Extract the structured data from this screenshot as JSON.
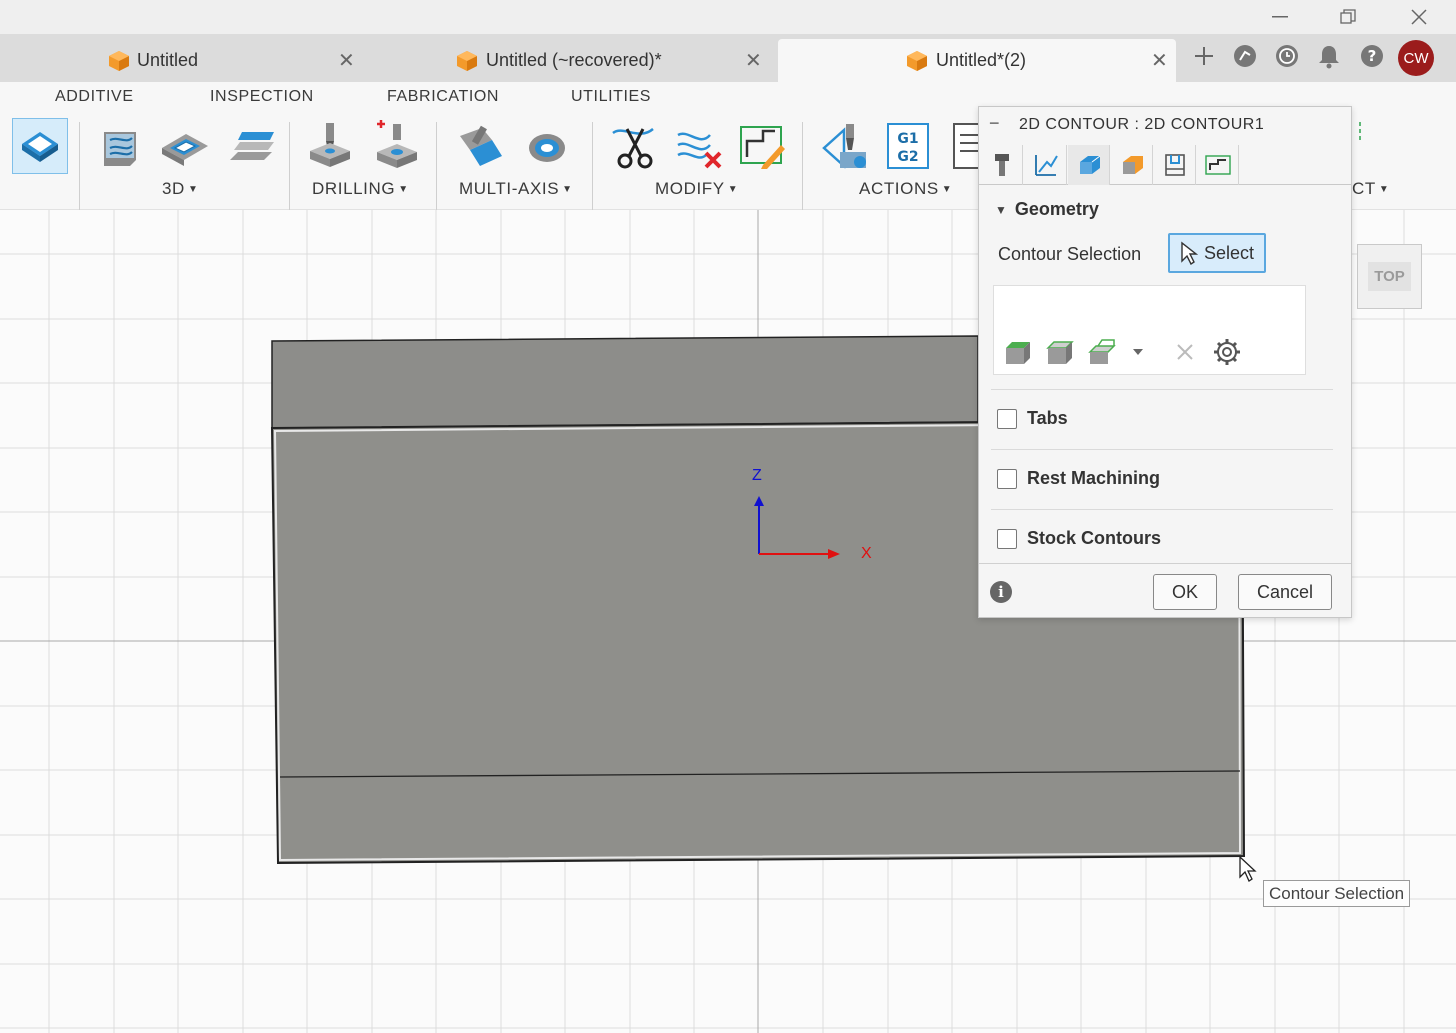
{
  "window": {
    "controls": [
      "minimize",
      "restore",
      "close"
    ]
  },
  "tabs": [
    {
      "label": "Untitled",
      "active": false
    },
    {
      "label": "Untitled (~recovered)*",
      "active": false
    },
    {
      "label": "Untitled*(2)",
      "active": true
    }
  ],
  "header_icons": [
    "plus-icon",
    "extensions-icon",
    "job-status-icon",
    "notification-bell-icon",
    "help-icon"
  ],
  "user": {
    "initials": "CW",
    "color": "#9b1c1c"
  },
  "ribbon": {
    "tabs": [
      "ADDITIVE",
      "INSPECTION",
      "FABRICATION",
      "UTILITIES"
    ],
    "groups": [
      {
        "label": "3D"
      },
      {
        "label": "DRILLING"
      },
      {
        "label": "MULTI-AXIS"
      },
      {
        "label": "MODIFY"
      },
      {
        "label": "ACTIONS"
      },
      {
        "label": "CT"
      }
    ]
  },
  "canvas": {
    "axis_z": "Z",
    "axis_x": "X",
    "viewcube_label": "TOP"
  },
  "dialog": {
    "title": "2D CONTOUR : 2D CONTOUR1",
    "tabs": [
      "tool",
      "passes",
      "geometry",
      "heights",
      "linking",
      "post-process"
    ],
    "section": "Geometry",
    "contour_selection_label": "Contour Selection",
    "select_button": "Select",
    "checkboxes": [
      {
        "label": "Tabs",
        "checked": false
      },
      {
        "label": "Rest Machining",
        "checked": false
      },
      {
        "label": "Stock Contours",
        "checked": false
      }
    ],
    "ok": "OK",
    "cancel": "Cancel"
  },
  "tooltip": "Contour Selection",
  "colors": {
    "accent": "#5aa7df",
    "part": "#8d8d8a",
    "x_axis": "#e01010",
    "z_axis": "#1010d0"
  }
}
